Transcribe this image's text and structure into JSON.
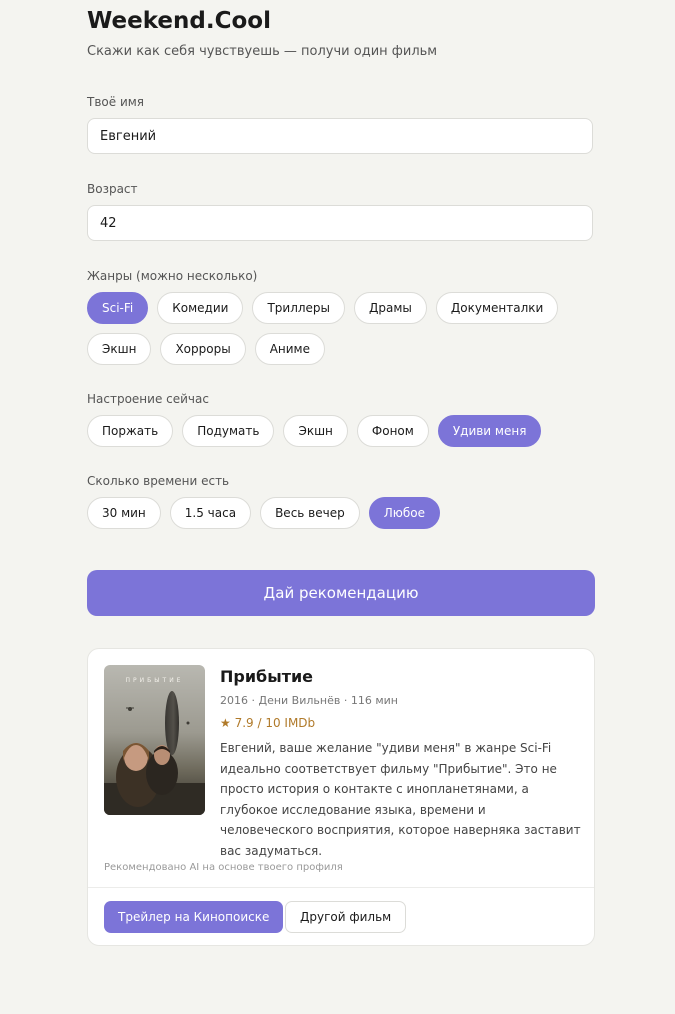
{
  "header": {
    "title": "Weekend.Cool",
    "subtitle": "Скажи как себя чувствуешь — получи один фильм"
  },
  "form": {
    "name": {
      "label": "Твоё имя",
      "value": "Евгений"
    },
    "age": {
      "label": "Возраст",
      "value": "42"
    },
    "genres": {
      "label": "Жанры (можно несколько)",
      "row1": [
        {
          "label": "Sci-Fi",
          "selected": true
        },
        {
          "label": "Комедии",
          "selected": false
        },
        {
          "label": "Триллеры",
          "selected": false
        },
        {
          "label": "Драмы",
          "selected": false
        },
        {
          "label": "Документалки",
          "selected": false
        }
      ],
      "row2": [
        {
          "label": "Экшн",
          "selected": false
        },
        {
          "label": "Хорроры",
          "selected": false
        },
        {
          "label": "Аниме",
          "selected": false
        }
      ]
    },
    "mood": {
      "label": "Настроение сейчас",
      "options": [
        {
          "label": "Поржать",
          "selected": false
        },
        {
          "label": "Подумать",
          "selected": false
        },
        {
          "label": "Экшн",
          "selected": false
        },
        {
          "label": "Фоном",
          "selected": false
        },
        {
          "label": "Удиви меня",
          "selected": true
        }
      ]
    },
    "time": {
      "label": "Сколько времени есть",
      "options": [
        {
          "label": "30 мин",
          "selected": false
        },
        {
          "label": "1.5 часа",
          "selected": false
        },
        {
          "label": "Весь вечер",
          "selected": false
        },
        {
          "label": "Любое",
          "selected": true
        }
      ]
    },
    "submit_label": "Дай рекомендацию"
  },
  "result": {
    "poster_text": "ПРИБЫТИЕ",
    "title": "Прибытие",
    "meta": "2016 · Дени Вильнёв · 116 мин",
    "rating": "★ 7.9 / 10 IMDb",
    "description": "Евгений, ваше желание \"удиви меня\" в жанре Sci-Fi идеально соответствует фильму \"Прибытие\". Это не просто история о контакте с инопланетянами, а глубокое исследование языка, времени и человеческого восприятия, которое наверняка заставит вас задуматься.",
    "ai_note": "Рекомендовано AI на основе твоего профиля",
    "trailer_label": "Трейлер на Кинопоиске",
    "other_label": "Другой фильм"
  },
  "colors": {
    "accent": "#7c74d8",
    "background": "#f4f4f0",
    "rating": "#b07a2a"
  }
}
